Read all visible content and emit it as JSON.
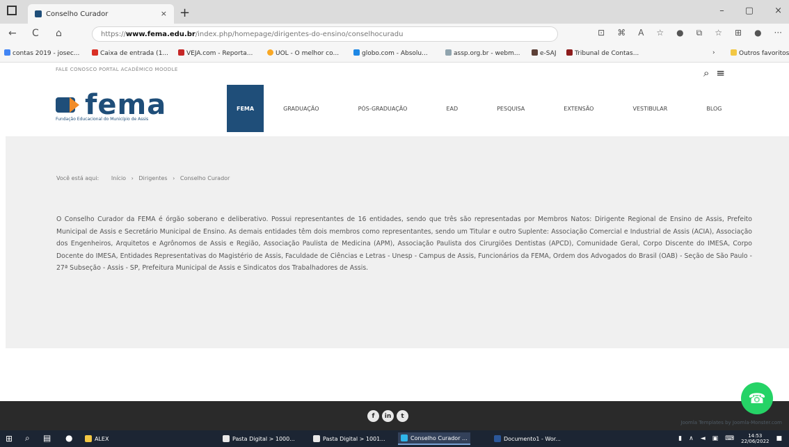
{
  "browser": {
    "tab_title": "Conselho Curador",
    "tab_close": "×",
    "new_tab": "+",
    "url_prefix": "https://",
    "url_host": "www.fema.edu.br",
    "url_path": "/index.php/homepage/dirigentes-do-ensino/conselhocuradu",
    "window_controls": [
      "–",
      "▢",
      "×"
    ],
    "nav": {
      "back": "←",
      "reload": "C",
      "home": "⌂"
    },
    "addr_icons": [
      "⊡",
      "⌘",
      "A",
      "☆",
      "●",
      "⧉",
      "☆",
      "⊞",
      "●",
      "···"
    ],
    "bookmarks": [
      {
        "label": "contas 2019 - josec...",
        "color": "#4285f4"
      },
      {
        "label": "Caixa de entrada (1...",
        "color": "#d93025"
      },
      {
        "label": "VEJA.com - Reporta...",
        "color": "#c62828"
      },
      {
        "label": "UOL - O melhor co...",
        "color": "#f9a825"
      },
      {
        "label": "globo.com - Absolu...",
        "color": "#1e88e5"
      },
      {
        "label": "assp.org.br - webm...",
        "color": "#90a4ae"
      },
      {
        "label": "e-SAJ",
        "color": "#5d4037"
      },
      {
        "label": "Tribunal de Contas...",
        "color": "#8d1c1c"
      }
    ],
    "bookmarks_more": "›",
    "other_favorites": "Outros favoritos"
  },
  "site": {
    "toplinks": "FALE CONOSCO  PORTAL ACADÊMICO  MOODLE",
    "search_icon": "search-icon",
    "menu_icon": "hamburger-icon",
    "logo_word": "fema",
    "logo_tagline": "Fundação Educacional do Município de Assis",
    "nav": [
      {
        "label": "FEMA",
        "active": true
      },
      {
        "label": "GRADUAÇÃO"
      },
      {
        "label": "PÓS-GRADUAÇÃO"
      },
      {
        "label": "EAD"
      },
      {
        "label": "PESQUISA"
      },
      {
        "label": "EXTENSÃO"
      },
      {
        "label": "VESTIBULAR"
      },
      {
        "label": "BLOG"
      }
    ],
    "breadcrumb": {
      "prefix": "Você está aqui:",
      "items": [
        "Início",
        "Dirigentes",
        "Conselho Curador"
      ],
      "separator": "›"
    },
    "description": "O Conselho Curador da FEMA é órgão soberano e deliberativo. Possui representantes de 16 entidades, sendo que três são representadas por Membros Natos: Dirigente Regional de Ensino de Assis, Prefeito Municipal de Assis e Secretário Municipal de Ensino. As demais entidades têm dois membros como representantes, sendo um Titular e outro Suplente: Associação Comercial e Industrial de Assis (ACIA), Associação dos Engenheiros, Arquitetos e Agrônomos de Assis e Região, Associação Paulista de Medicina (APM), Associação Paulista dos Cirurgiões Dentistas (APCD), Comunidade Geral, Corpo Discente do IMESA, Corpo Docente do IMESA, Entidades Representativas do Magistério de Assis, Faculdade de Ciências e Letras - Unesp - Campus de Assis, Funcionários da FEMA, Ordem dos Advogados do Brasil (OAB) - Seção de São Paulo - 27ª Subseção - Assis - SP, Prefeitura Municipal de Assis e Sindicatos dos Trabalhadores de Assis.",
    "footer_social": [
      "f",
      "in",
      "t"
    ],
    "footer_credit": "Joomla Templates by Joomla-Monster.com"
  },
  "taskbar": {
    "apps": [
      {
        "label": "ALEX",
        "active": false
      },
      {
        "label": "Pasta Digital > 1000...",
        "active": false
      },
      {
        "label": "Pasta Digital > 1001...",
        "active": false
      },
      {
        "label": "Conselho Curador ...",
        "active": true
      },
      {
        "label": "Documento1 - Wor...",
        "active": false
      }
    ],
    "time": "14:53",
    "date": "22/06/2022"
  }
}
